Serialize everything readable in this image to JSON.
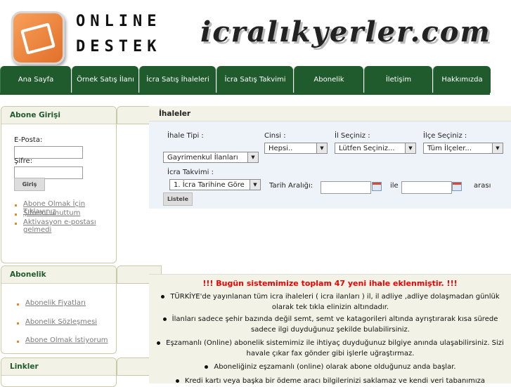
{
  "header": {
    "logo_line1": "ONLINE",
    "logo_line2": "DESTEK",
    "site_title": "icralıkyerler.com"
  },
  "nav": {
    "items": [
      {
        "label": "Ana Sayfa"
      },
      {
        "label": "Örnek Satış İlanı"
      },
      {
        "label": "İcra Satış İhaleleri"
      },
      {
        "label": "İcra Satış Takvimi"
      },
      {
        "label": "Abonelik"
      },
      {
        "label": "İletişim"
      },
      {
        "label": "Hakkımızda"
      }
    ]
  },
  "sidebar": {
    "login": {
      "title": "Abone Girişi",
      "email_label": "E-Posta:",
      "password_label": "Şifre:",
      "login_button": "Giriş",
      "links": [
        "Abone Olmak İçin Tıklayınız",
        "Şifremi unuttum",
        "Aktivasyon e-postası gelmedi"
      ]
    },
    "subscription": {
      "title": "Abonelik",
      "links": [
        "Abonelik Fiyatları",
        "Abonelik Sözleşmesi",
        "Abone Olmak İstiyorum"
      ]
    },
    "links_box": {
      "title": "Linkler"
    }
  },
  "main": {
    "title": "İhaleler",
    "filters": {
      "tender_type_label": "İhale Tipi :",
      "tender_type_value": "Gayrimenkul İlanları",
      "kind_label": "Cinsi :",
      "kind_value": "Hepsi..",
      "city_label": "İl Seçiniz :",
      "city_value": "Lütfen Seçiniz...",
      "district_label": "İlçe Seçiniz :",
      "district_value": "Tüm İlçeler...",
      "calendar_label": "İcra Takvimi :",
      "calendar_value": "1. İcra Tarihine Göre",
      "date_range_label": "Tarih Aralığı:",
      "and_label": "ile",
      "between_label": "arası",
      "list_button": "Listele"
    },
    "announcement": {
      "headline": "!!! Bugün sistemimize toplam 47 yeni ihale eklenmiştir. !!!",
      "items": [
        "TÜRKİYE'de yayınlanan tüm icra ihaleleri ( icra ilanları ) il, il adliye ,adliye dolaşmadan günlük olarak tek tıkla elinizin altındadır.",
        "İlanları sadece şehir bazında değil semt, semt ve katagorileri altında ayrıştırarak kısa sürede sadece ilgi duyduğunuz şekilde bulabilirsiniz.",
        "Eşzamanlı (Online) abonelik sistemimiz ile ihtiyaç duyduğunuz bilgiye anında ulaşabilirsiniz. Sizi havale çıkar fax gönder gibi işlerle uğraştırmaz.",
        "Aboneliğiniz eşzamanlı (online) olarak abone olduğunuz anda başlar.",
        "Kredi kartı veya başka bir ödeme aracı bilgilerinizi saklamaz ve kendi veri tabanımıza"
      ]
    }
  }
}
